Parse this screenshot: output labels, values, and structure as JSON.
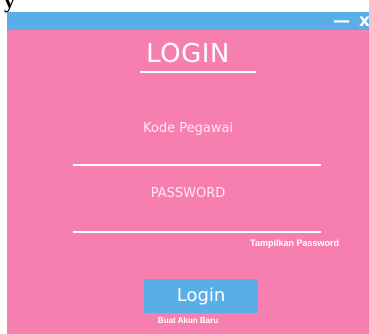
{
  "header_fragment": {
    "text": "y"
  },
  "window": {
    "minimize_label": "—",
    "close_label": "x"
  },
  "login_form": {
    "title": "LOGIN",
    "employee_code_placeholder": "Kode Pegawai",
    "password_placeholder": "PASSWORD",
    "show_password_label": "Tampilkan Password",
    "login_button_label": "Login",
    "create_account_label": "Buat Akun Baru"
  },
  "colors": {
    "window_background": "#f77faf",
    "accent": "#5aaee7",
    "text": "#ffffff"
  }
}
